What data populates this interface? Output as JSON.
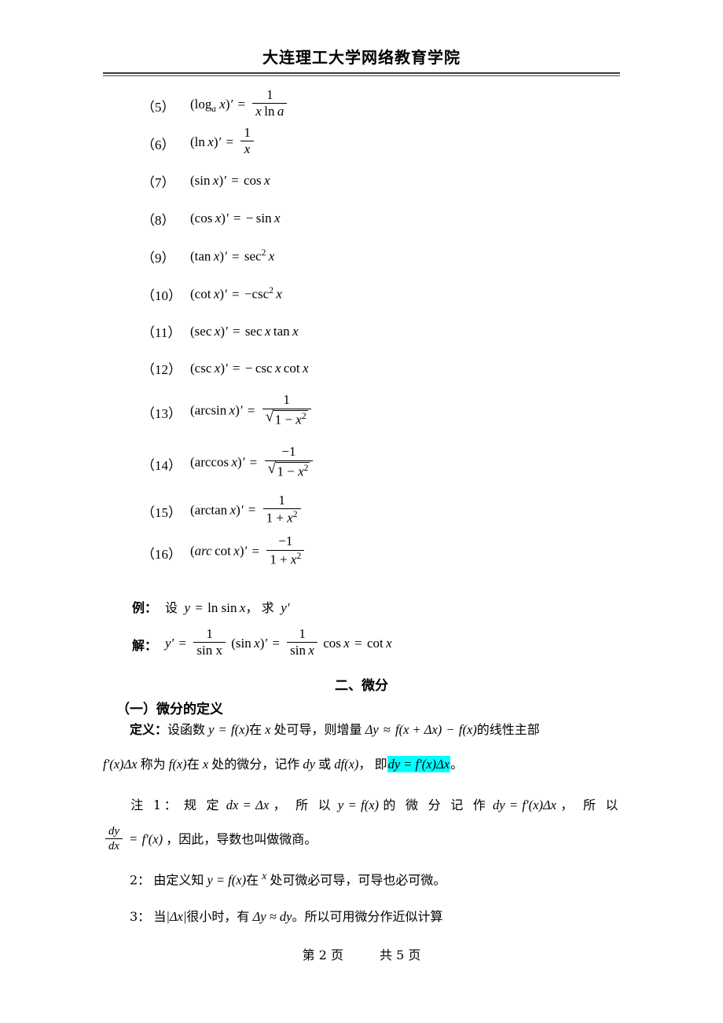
{
  "header": {
    "title": "大连理工大学网络教育学院"
  },
  "formulas": [
    {
      "num": "（5）",
      "expr": "(log_a x)' = 1/(x ln a)"
    },
    {
      "num": "（6）",
      "expr": "(ln x)' = 1/x"
    },
    {
      "num": "（7）",
      "expr": "(sin x)' = cos x"
    },
    {
      "num": "（8）",
      "expr": "(cos x)' = − sin x"
    },
    {
      "num": "（9）",
      "expr": "(tan x)' = sec² x"
    },
    {
      "num": "（10）",
      "expr": "(cot x)' = − csc² x"
    },
    {
      "num": "（11）",
      "expr": "(sec x)' = sec x tan x"
    },
    {
      "num": "（12）",
      "expr": "(csc x)' = − csc x cot x"
    },
    {
      "num": "（13）",
      "expr": "(arcsin x)' = 1/√(1 − x²)"
    },
    {
      "num": "（14）",
      "expr": "(arccos x)' = −1/√(1 − x²)"
    },
    {
      "num": "（15）",
      "expr": "(arctan x)' = 1/(1 + x²)"
    },
    {
      "num": "（16）",
      "expr": "(arc cot x)' = −1/(1 + x²)"
    }
  ],
  "example": {
    "label": "例：",
    "text_she": "设",
    "y_eq": "y",
    "eq": "=",
    "ln_sin": "ln sin",
    "x": "x",
    "comma": "，",
    "text_qiu": "求",
    "yprime": "y′",
    "solution_label": "解：",
    "sol_yprime": "y′",
    "sol_eq1": "=",
    "sol_one": "1",
    "sol_sinx": "sin x",
    "sol_sinxprime": "(sin x)′",
    "sol_eq2": "=",
    "sol_cosx": "cos x",
    "sol_eq3": "=",
    "sol_cotx": "cot x"
  },
  "sections": {
    "heading_2": "二、微分",
    "sub_1": "（一）微分的定义"
  },
  "definition": {
    "label": "定义：",
    "line1_a": "设函数",
    "line1_y": "y",
    "line1_eq": "=",
    "line1_fx": "f(x)",
    "line1_zai": "在",
    "line1_x": "x",
    "line1_chukedao": "处可导，则增量",
    "line1_dy": "Δy",
    "line1_approx": "≈",
    "line1_fxdx": "f(x + Δx)",
    "line1_minus": "−",
    "line1_fx2": "f(x)",
    "line1_tail": "的线性主部",
    "line2_fprime": "f′(x)Δx",
    "line2_chengwei": "称为",
    "line2_fx": "f(x)",
    "line2_zai": "在",
    "line2_x": "x",
    "line2_chu": "处的微分，记作",
    "line2_dy": "dy",
    "line2_huo": "或",
    "line2_dfx": "df(x)",
    "line2_comma": "，",
    "line2_ji": "即",
    "line2_highlight": "dy = f′(x)Δx",
    "line2_period": "。"
  },
  "notes": [
    {
      "id": "note-1",
      "label": "注 1：",
      "text_a": "规 定",
      "m_dx": "dx = Δx",
      "text_b": "， 所 以",
      "m_y": "y = f(x)",
      "text_c": "的 微 分 记 作",
      "m_dy": "dy = f′(x)Δx",
      "text_d": "， 所 以",
      "frac_num": "dy",
      "frac_den": "dx",
      "eq": "=",
      "m_fprime": "f′(x)",
      "text_e": "，因此，导数也叫做微商。"
    },
    {
      "id": "note-2",
      "label": "2：",
      "text_a": "由定义知",
      "m_y": "y = f(x)",
      "text_b": "在",
      "m_x": "x",
      "text_c": "处可微必可导，可导也必可微。"
    },
    {
      "id": "note-3",
      "label": "3：",
      "text_a": "当",
      "m_dx": "|Δx|",
      "text_b": "很小时，有",
      "m_dydy": "Δy ≈ dy",
      "text_c": "。所以可用微分作近似计算"
    }
  ],
  "footer": {
    "page_label": "第 2 页",
    "total_label": "共 5 页"
  },
  "colors": {
    "highlight": "#00ffff",
    "rule": "#3a3a3a",
    "text": "#000000"
  }
}
